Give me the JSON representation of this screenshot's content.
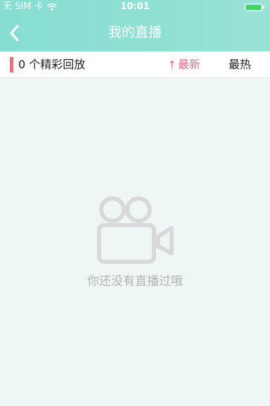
{
  "status_bar": {
    "carrier": "无 SIM 卡",
    "time": "10:01",
    "battery_color": "#3fd35f"
  },
  "nav": {
    "back_icon": "chevron-left-icon",
    "title": "我的直播"
  },
  "filter": {
    "count_label": "0 个精彩回放",
    "sort_newest_arrow": "↑",
    "sort_newest_label": "最新",
    "sort_hottest_label": "最热",
    "accent_color": "#e07585"
  },
  "empty_state": {
    "icon": "video-camera-icon",
    "message": "你还没有直播过哦"
  }
}
